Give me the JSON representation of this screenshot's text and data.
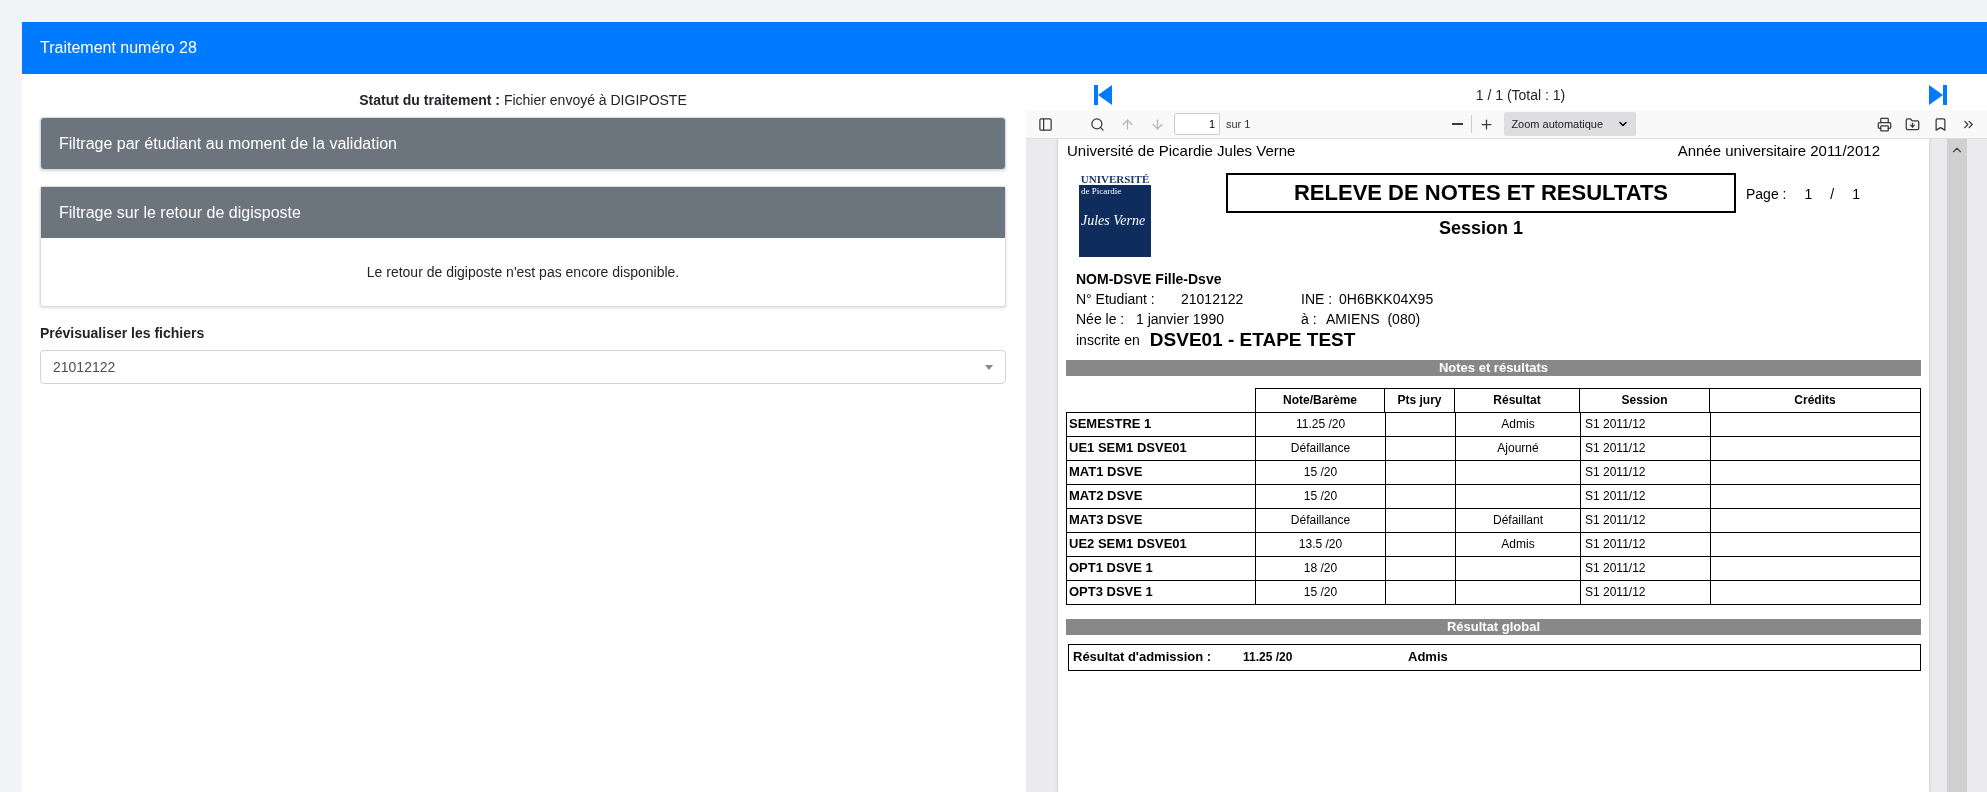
{
  "card": {
    "title": "Traitement numéro 28"
  },
  "status": {
    "label": "Statut du traitement :",
    "value": "Fichier envoyé à DIGIPOSTE"
  },
  "panels": [
    {
      "title": "Filtrage par étudiant au moment de la validation",
      "expanded": false
    },
    {
      "title": "Filtrage sur le retour de digisposte",
      "expanded": true,
      "body": "Le retour de digiposte n'est pas encore disponible."
    }
  ],
  "preview": {
    "label": "Prévisualiser les fichiers",
    "value": "21012122"
  },
  "pager": {
    "text": "1 / 1 (Total : 1)"
  },
  "toolbar": {
    "page_input": "1",
    "page_count": "sur 1",
    "zoom": "Zoom automatique",
    "left": [
      {
        "kind": "sidebar",
        "disabled": false
      },
      {
        "kind": "search",
        "disabled": false
      },
      {
        "kind": "up",
        "disabled": true
      },
      {
        "kind": "down",
        "disabled": true
      }
    ],
    "right": [
      {
        "kind": "print",
        "disabled": false
      },
      {
        "kind": "save",
        "disabled": false
      },
      {
        "kind": "bookmark",
        "disabled": false
      },
      {
        "kind": "more",
        "disabled": false
      }
    ]
  },
  "document": {
    "university": "Université de Picardie Jules Verne",
    "year": "Année universitaire 2011/2012",
    "logo": [
      "UNIVERSITÉ",
      "de Picardie",
      "Jules Verne"
    ],
    "title": "RELEVE DE NOTES ET RESULTATS",
    "page_label": "Page :",
    "page_num": "1",
    "page_sep": "/",
    "page_total": "1",
    "session": "Session 1",
    "student": {
      "name": "NOM-DSVE Fille-Dsve",
      "id_label": "N° Etudiant :",
      "id": "21012122",
      "ine_label": "INE :",
      "ine": "0H6BKK04X95",
      "birth_label": "Née le :",
      "birth": "1 janvier 1990",
      "place_label": "à :",
      "place": "AMIENS  (080)",
      "enrolled_label": "inscrite en",
      "enrolled": "DSVE01 - ETAPE TEST"
    },
    "notes_title": "Notes et résultats",
    "columns": [
      "",
      "Note/Barème",
      "Pts jury",
      "Résultat",
      "Session",
      "Crédits"
    ],
    "rows": [
      [
        "SEMESTRE 1",
        "11.25 /20",
        "",
        "Admis",
        "S1 2011/12",
        ""
      ],
      [
        "UE1 SEM1 DSVE01",
        "Défaillance",
        "",
        "Ajourné",
        "S1 2011/12",
        ""
      ],
      [
        "MAT1 DSVE",
        "15 /20",
        "",
        "",
        "S1 2011/12",
        ""
      ],
      [
        "MAT2 DSVE",
        "15 /20",
        "",
        "",
        "S1 2011/12",
        ""
      ],
      [
        "MAT3 DSVE",
        "Défaillance",
        "",
        "Défaillant",
        "S1 2011/12",
        ""
      ],
      [
        "UE2 SEM1 DSVE01",
        "13.5 /20",
        "",
        "Admis",
        "S1 2011/12",
        ""
      ],
      [
        "OPT1 DSVE 1",
        "18 /20",
        "",
        "",
        "S1 2011/12",
        ""
      ],
      [
        "OPT3 DSVE 1",
        "15 /20",
        "",
        "",
        "S1 2011/12",
        ""
      ]
    ],
    "global_title": "Résultat global",
    "global": {
      "label": "Résultat d'admission :",
      "score": "11.25 /20",
      "result": "Admis"
    }
  }
}
